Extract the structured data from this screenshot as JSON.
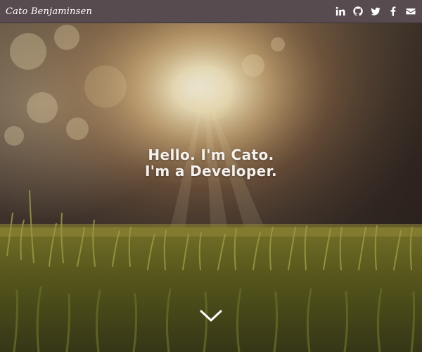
{
  "nav": {
    "brand": "Cato Benjaminsen",
    "social": [
      {
        "icon": "linkedin-icon"
      },
      {
        "icon": "github-icon"
      },
      {
        "icon": "twitter-icon"
      },
      {
        "icon": "facebook-icon"
      },
      {
        "icon": "email-icon"
      }
    ]
  },
  "hero": {
    "line1": "Hello. I'm Cato.",
    "line2": "I'm a Developer.",
    "scroll_icon": "chevron-down-icon"
  },
  "colors": {
    "navbar_bg": "#574b4f",
    "text": "#ffffff",
    "sun": "#fff6d8",
    "grass": "#8a8f2a"
  }
}
